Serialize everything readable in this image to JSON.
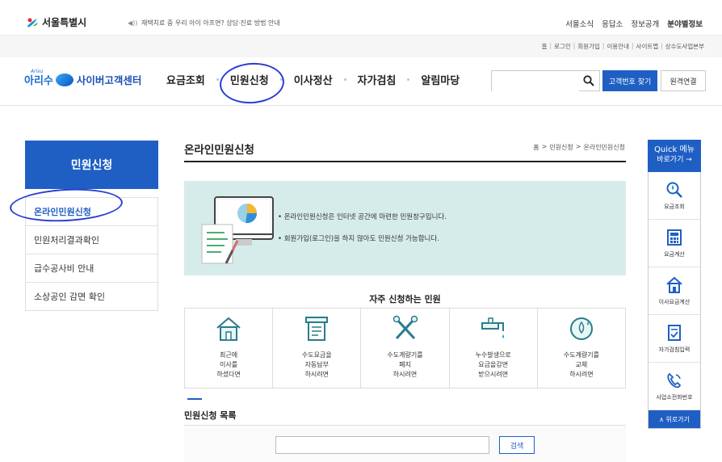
{
  "top": {
    "site_name": "서울특별시",
    "notice": "재택치료 중 우리 아이 아프면? 상담·진료 방법 안내",
    "links": [
      "서울소식",
      "응답소",
      "정보공개",
      "분야별정보"
    ]
  },
  "util": {
    "links": [
      "홈",
      "로그인",
      "회원가입",
      "이용안내",
      "사이트맵",
      "상수도사업본부"
    ]
  },
  "header": {
    "logo_small": "Arisu",
    "logo_ari": "아리수",
    "logo_name": "사이버고객센터",
    "nav": [
      "요금조회",
      "민원신청",
      "이사정산",
      "자가검침",
      "알림마당"
    ],
    "search_placeholder": "",
    "customer_button": "고객번호 찾기",
    "remote_button": "원격연결"
  },
  "lnb": {
    "title": "민원신청",
    "items": [
      "온라인민원신청",
      "민원처리결과확인",
      "급수공사비 안내",
      "소상공인 감면 확인"
    ]
  },
  "content": {
    "title": "온라인민원신청",
    "breadcrumb": [
      "홈",
      ">",
      "민원신청",
      ">",
      "온라인민원신청"
    ],
    "info_lines": [
      "• 온라인민원신청은 인터넷 공간에 마련한 민원창구입니다.",
      "• 회원가입(로그인)을 하지 않아도 민원신청 가능합니다."
    ],
    "freq_title": "자주 신청하는 민원",
    "cards": [
      {
        "icon": "house-icon",
        "label": "최근에\n이사를\n하셨다면"
      },
      {
        "icon": "bill-icon",
        "label": "수도요금을\n자동납부\n하시려면"
      },
      {
        "icon": "tools-icon",
        "label": "수도계량기를\n폐지\n하시려면"
      },
      {
        "icon": "faucet-leak-icon",
        "label": "누수발생으로\n요금을감면\n받으시려면"
      },
      {
        "icon": "meter-icon",
        "label": "수도계량기를\n교체\n하시려면"
      }
    ],
    "list_title": "민원신청 목록",
    "list_search_button": "검색"
  },
  "quick": {
    "title_line1": "Quick 메뉴",
    "title_line2": "바로가기 →",
    "items": [
      {
        "icon": "magnifier-drop-icon",
        "label": "요금조회"
      },
      {
        "icon": "calculator-icon",
        "label": "요금계산"
      },
      {
        "icon": "house-move-icon",
        "label": "이사요금계산"
      },
      {
        "icon": "checklist-icon",
        "label": "자가검침입력"
      },
      {
        "icon": "phone-icon",
        "label": "사업소전화번호"
      }
    ],
    "top_button": "∧ 위로가기"
  },
  "colors": {
    "brand": "#1f5fc4",
    "info_bg": "#d6ecea",
    "annotation": "#2a3dd6"
  }
}
